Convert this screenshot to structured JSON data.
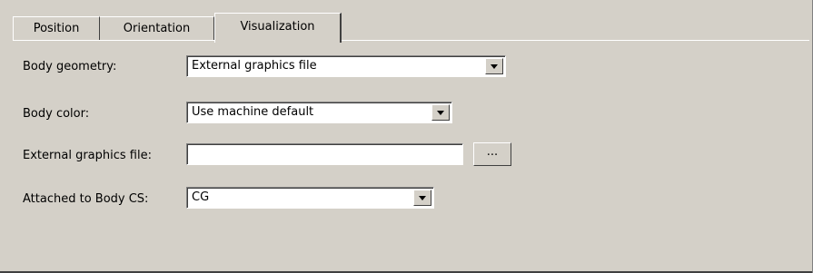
{
  "tabs": [
    {
      "label": "Position",
      "active": false
    },
    {
      "label": "Orientation",
      "active": false
    },
    {
      "label": "Visualization",
      "active": true
    }
  ],
  "form": {
    "body_geometry": {
      "label": "Body geometry:",
      "value": "External graphics file"
    },
    "body_color": {
      "label": "Body color:",
      "value": "Use machine default"
    },
    "external_graphics_file": {
      "label": "External graphics file:",
      "value": "",
      "browse_label": "..."
    },
    "attached_to_body_cs": {
      "label": "Attached to Body CS:",
      "value": "CG"
    }
  },
  "colors": {
    "panel_background": "#d4d0c8",
    "field_background": "#ffffff"
  }
}
